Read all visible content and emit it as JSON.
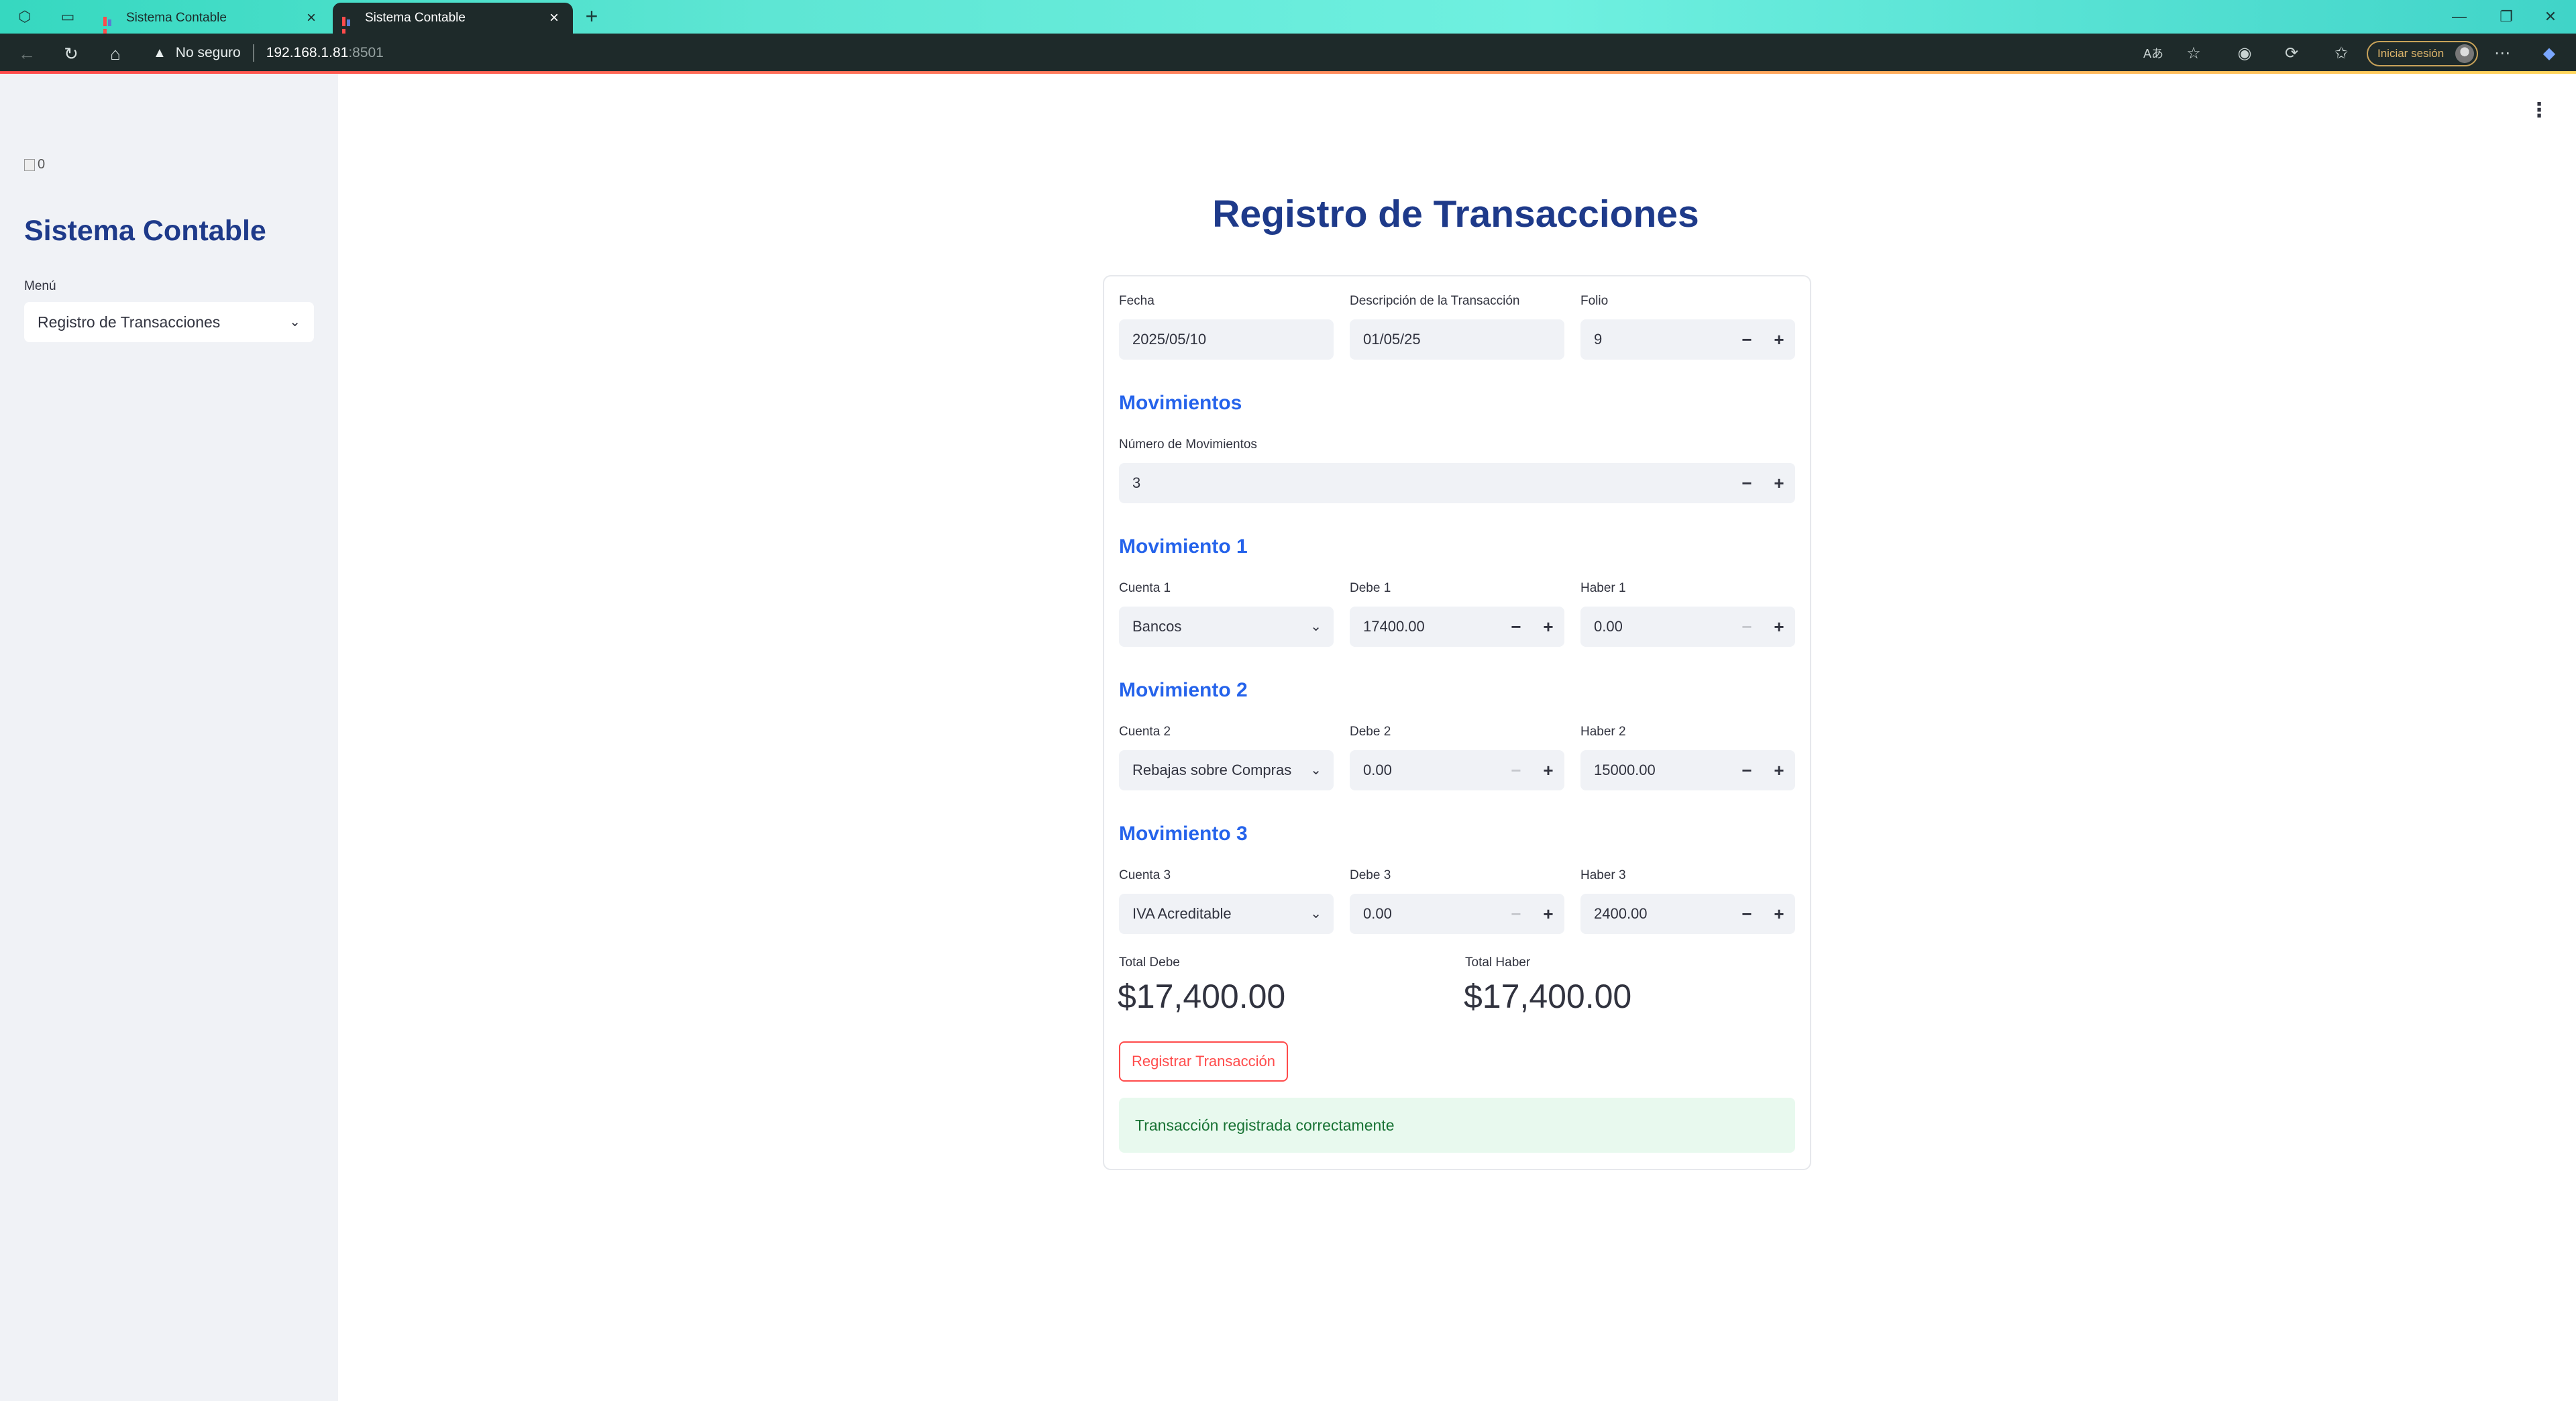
{
  "browser": {
    "tabs": [
      {
        "title": "Sistema Contable",
        "active": false
      },
      {
        "title": "Sistema Contable",
        "active": true
      }
    ],
    "security_label": "No seguro",
    "url_host": "192.168.1.81",
    "url_port": ":8501",
    "signin_label": "Iniciar sesión"
  },
  "sidebar": {
    "logo_alt": "0",
    "title": "Sistema Contable",
    "menu_label": "Menú",
    "menu_selected": "Registro de Transacciones"
  },
  "main": {
    "title": "Registro de Transacciones",
    "fecha": {
      "label": "Fecha",
      "value": "2025/05/10"
    },
    "descripcion": {
      "label": "Descripción de la Transacción",
      "value": "01/05/25"
    },
    "folio": {
      "label": "Folio",
      "value": "9"
    },
    "movimientos_heading": "Movimientos",
    "num_movimientos": {
      "label": "Número de Movimientos",
      "value": "3"
    },
    "movements": [
      {
        "heading": "Movimiento 1",
        "cuenta_label": "Cuenta 1",
        "cuenta": "Bancos",
        "debe_label": "Debe 1",
        "debe": "17400.00",
        "haber_label": "Haber 1",
        "haber": "0.00"
      },
      {
        "heading": "Movimiento 2",
        "cuenta_label": "Cuenta 2",
        "cuenta": "Rebajas sobre Compras",
        "debe_label": "Debe 2",
        "debe": "0.00",
        "haber_label": "Haber 2",
        "haber": "15000.00"
      },
      {
        "heading": "Movimiento 3",
        "cuenta_label": "Cuenta 3",
        "cuenta": "IVA Acreditable",
        "debe_label": "Debe 3",
        "debe": "0.00",
        "haber_label": "Haber 3",
        "haber": "2400.00"
      }
    ],
    "total_debe": {
      "label": "Total Debe",
      "value": "$17,400.00"
    },
    "total_haber": {
      "label": "Total Haber",
      "value": "$17,400.00"
    },
    "register_button": "Registrar Transacción",
    "success_message": "Transacción registrada correctamente"
  },
  "colors": {
    "title_blue": "#1e3a8a",
    "section_blue": "#2563eb",
    "primary_red": "#ff4b4b",
    "success_green": "#177233"
  }
}
